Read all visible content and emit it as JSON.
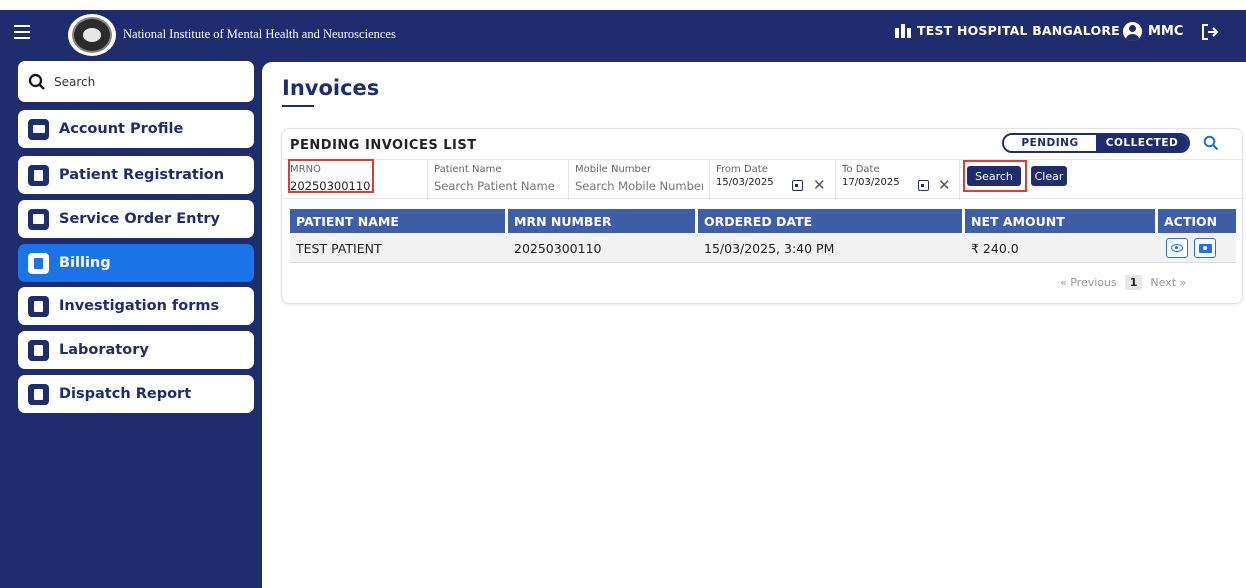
{
  "header": {
    "institute_name": "National Institute of Mental Health and Neurosciences",
    "hospital_name": "TEST HOSPITAL BANGALORE",
    "user": "MMC"
  },
  "sidebar": {
    "search_placeholder": "Search",
    "items": [
      {
        "label": "Account Profile",
        "icon": "id-card-icon"
      },
      {
        "label": "Patient Registration",
        "icon": "pen-file-icon"
      },
      {
        "label": "Service Order Entry",
        "icon": "lab-icon"
      },
      {
        "label": "Billing",
        "icon": "file-icon",
        "active": true
      },
      {
        "label": "Investigation forms",
        "icon": "file-icon"
      },
      {
        "label": "Laboratory",
        "icon": "file-icon"
      },
      {
        "label": "Dispatch Report",
        "icon": "file-icon"
      }
    ]
  },
  "page": {
    "title": "Invoices"
  },
  "card": {
    "title": "PENDING INVOICES LIST",
    "toggle_pending": "PENDING",
    "toggle_collected": "COLLECTED",
    "active_toggle": "COLLECTED"
  },
  "filters": {
    "mrno_label": "MRNO",
    "mrno_value": "20250300110",
    "patient_name_label": "Patient Name",
    "patient_name_placeholder": "Search Patient Name",
    "mobile_label": "Mobile Number",
    "mobile_placeholder": "Search Mobile Number",
    "from_label": "From Date",
    "from_value": "15/03/2025",
    "to_label": "To Date",
    "to_value": "17/03/2025",
    "search_btn": "Search",
    "clear_btn": "Clear"
  },
  "table": {
    "headers": [
      "PATIENT NAME",
      "MRN NUMBER",
      "ORDERED DATE",
      "NET AMOUNT",
      "ACTION"
    ],
    "rows": [
      {
        "patient_name": "TEST PATIENT",
        "mrn": "20250300110",
        "ordered_date": "15/03/2025, 3:40 PM",
        "net_amount": "₹ 240.0"
      }
    ]
  },
  "pagination": {
    "previous": "« Previous",
    "page": "1",
    "next": "Next »"
  },
  "colors": {
    "navy": "#1f2d6e",
    "header_blue": "#3f5ea8",
    "active_blue": "#1a73e8",
    "highlight_red": "#e53935"
  }
}
